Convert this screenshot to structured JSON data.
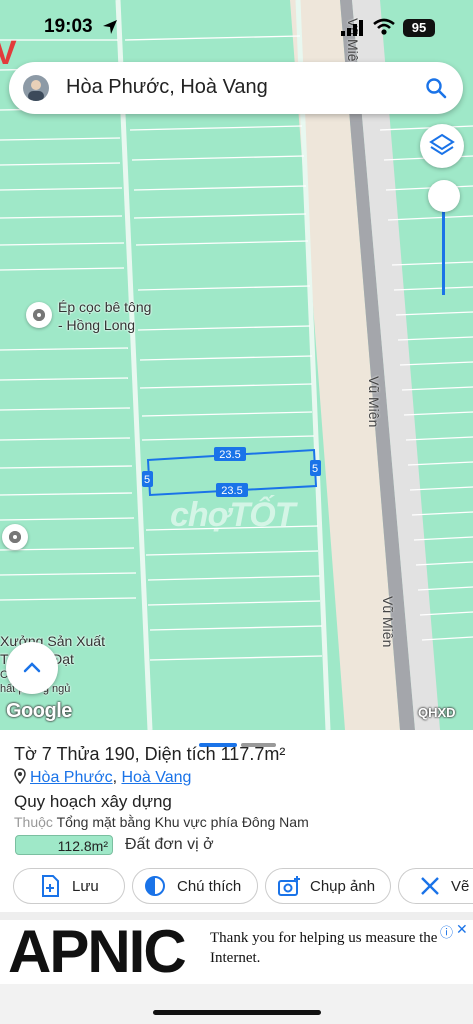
{
  "status_bar": {
    "time": "19:03",
    "battery": "95"
  },
  "search": {
    "text": "Hòa Phước, Hoà Vang"
  },
  "map": {
    "pois": [
      {
        "line1": "Ép cọc bê tông",
        "line2": "- Hồng Long"
      },
      {
        "line1": "Xưởng Sản Xuất",
        "line2": "Tủ Bích Đạt",
        "line3": "Cửa hội",
        "line4": "hất phòng ngủ"
      }
    ],
    "roads": [
      "Vũ Miên",
      "Vũ Miên",
      "Vũ Miên"
    ],
    "plot": {
      "length_top": "23.5",
      "length_bottom": "23.5",
      "width_left": "5",
      "width_right": "5"
    },
    "watermark": "chợTỐT",
    "google": "Google",
    "badge": "QHXD"
  },
  "panel": {
    "title": "Tờ 7 Thửa 190, Diện tích 117.7m²",
    "ward": "Hòa Phước",
    "district": "Hoà Vang",
    "plan_title": "Quy hoạch xây dựng",
    "belongs_label": "Thuộc",
    "belongs_value": "Tổng mặt bằng Khu vực phía Đông Nam",
    "area": "112.8m²",
    "area_desc": "Đất đơn vị ở",
    "actions": {
      "save": "Lưu",
      "legend": "Chú thích",
      "capture": "Chụp ảnh",
      "draw": "Vẽ"
    }
  },
  "ad": {
    "brand": "APNIC",
    "text": "Thank you for helping us measure the Internet."
  },
  "colors": {
    "map_fill": "#9fe8c8",
    "road": "#e8dfd2",
    "accent": "#1a73e8"
  }
}
